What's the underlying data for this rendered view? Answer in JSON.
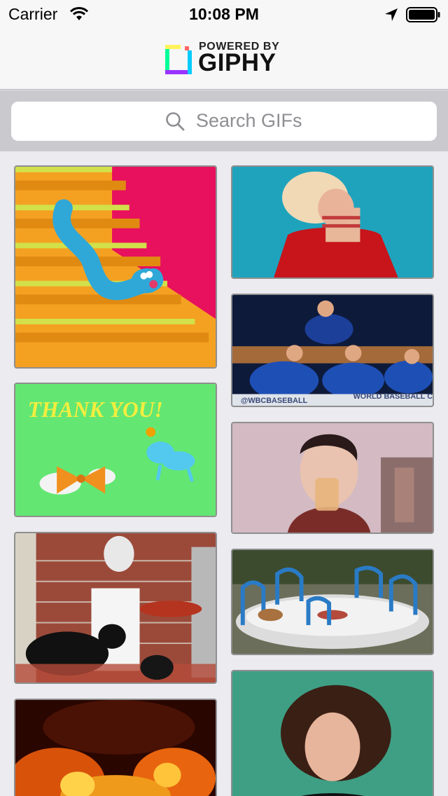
{
  "status_bar": {
    "carrier": "Carrier",
    "time": "10:08 PM"
  },
  "header": {
    "logo_powered": "POWERED BY",
    "logo_name": "GIPHY"
  },
  "search": {
    "placeholder": "Search GIFs"
  },
  "gifs": {
    "thank_you_text": "THANK YOU!",
    "wbc_text_left": "@WBCBASEBALL",
    "wbc_text_right": "WORLD BASEBALL C"
  }
}
